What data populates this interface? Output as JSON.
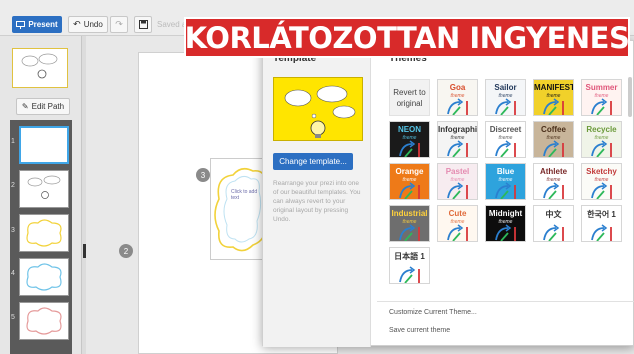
{
  "toolbar": {
    "present_label": "Present",
    "undo_label": "Undo",
    "saved_label": "Saved at"
  },
  "banner_text": "KORLÁTOZOTTAN INGYENES",
  "left_panel": {
    "edit_path_label": "Edit Path",
    "slide_numbers": [
      "1",
      "2",
      "3",
      "4",
      "5"
    ]
  },
  "canvas": {
    "frame_caption": "Click to add text",
    "step_labels": [
      "2",
      "3"
    ]
  },
  "template_panel": {
    "title": "Template",
    "change_button": "Change template...",
    "description": "Rearrange your prezi into one of our beautiful templates. You can always revert to your original layout by pressing Undo."
  },
  "themes_panel": {
    "title": "Themes",
    "revert_label": "Revert to original",
    "themes": [
      {
        "name": "Goa",
        "sub": "theme",
        "bg": "#f8f6f1",
        "color": "#d84c2a"
      },
      {
        "name": "Sailor",
        "sub": "theme",
        "bg": "#f4f6f8",
        "color": "#233a5c"
      },
      {
        "name": "MANIFESTO",
        "sub": "theme",
        "bg": "#f1d12a",
        "color": "#111111"
      },
      {
        "name": "Summer",
        "sub": "theme",
        "bg": "#fff3f1",
        "color": "#e0567a"
      },
      {
        "name": "NEON",
        "sub": "theme",
        "bg": "#1a1a1a",
        "color": "#55c6e8"
      },
      {
        "name": "Infographic",
        "sub": "theme",
        "bg": "#f4f4f4",
        "color": "#333333"
      },
      {
        "name": "Discreet",
        "sub": "theme",
        "bg": "#ffffff",
        "color": "#555555"
      },
      {
        "name": "Coffee",
        "sub": "theme",
        "bg": "#c8b59a",
        "color": "#4a2f1a"
      },
      {
        "name": "Recycle",
        "sub": "theme",
        "bg": "#f0f4e8",
        "color": "#6b9a3a"
      },
      {
        "name": "Orange",
        "sub": "theme",
        "bg": "#ee7a18",
        "color": "#ffffff"
      },
      {
        "name": "Pastel",
        "sub": "theme",
        "bg": "#f7ecf0",
        "color": "#e48ab0"
      },
      {
        "name": "Blue",
        "sub": "theme",
        "bg": "#2ea3dd",
        "color": "#ffffff"
      },
      {
        "name": "Athlete",
        "sub": "theme",
        "bg": "#ffffff",
        "color": "#7a2a2a"
      },
      {
        "name": "Sketchy",
        "sub": "theme",
        "bg": "#fbfbf7",
        "color": "#c23c3c"
      },
      {
        "name": "Industrial",
        "sub": "theme",
        "bg": "#6e6e6e",
        "color": "#ffd23c"
      },
      {
        "name": "Cute",
        "sub": "theme",
        "bg": "#fff8f0",
        "color": "#e06a3a"
      },
      {
        "name": "Midnight",
        "sub": "theme",
        "bg": "#0d0d0d",
        "color": "#ffffff"
      },
      {
        "name": "中文",
        "sub": "",
        "bg": "#ffffff",
        "color": "#333333"
      },
      {
        "name": "한국어 1",
        "sub": "",
        "bg": "#ffffff",
        "color": "#333333"
      },
      {
        "name": "日本語 1",
        "sub": "",
        "bg": "#ffffff",
        "color": "#333333"
      }
    ],
    "customize_label": "Customize Current Theme...",
    "save_label": "Save current theme"
  },
  "colors": {
    "accent_blue": "#2c6fc2",
    "banner_red": "#d82a2a",
    "template_yellow": "#ffe500",
    "arrow_green": "#2db85a",
    "arrow_blue": "#2b7fcf",
    "arrow_red": "#d8363a"
  }
}
